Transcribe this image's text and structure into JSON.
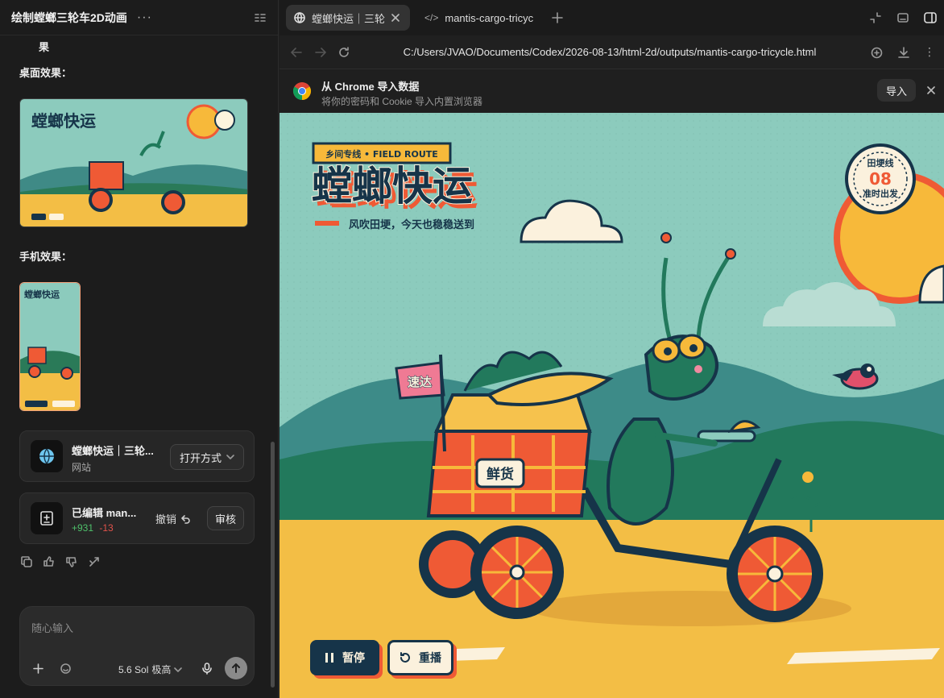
{
  "left": {
    "title": "绘制螳螂三轮车2D动画",
    "more": "···",
    "truncated_line": "果",
    "desktop_label": "桌面效果：",
    "mobile_label": "手机效果：",
    "website_card": {
      "title": "螳螂快运｜三轮...",
      "subtitle": "网站",
      "open_label": "打开方式"
    },
    "edit_card": {
      "title": "已编辑 man...",
      "added": "+931",
      "removed": "-13",
      "undo_label": "撤销",
      "review_label": "审核"
    },
    "composer": {
      "placeholder": "随心输入",
      "model": "5.6 Sol",
      "effort": "极高"
    }
  },
  "browser": {
    "tabs": [
      {
        "label": "螳螂快运｜三轮",
        "active": true
      },
      {
        "label": "mantis-cargo-tricyc",
        "active": false
      }
    ],
    "url": "C:/Users/JVAO/Documents/Codex/2026-08-13/html-2d/outputs/mantis-cargo-tricycle.html",
    "infobar": {
      "title": "从 Chrome 导入数据",
      "subtitle": "将你的密码和 Cookie 导入内置浏览器",
      "import_label": "导入"
    }
  },
  "scene": {
    "badge": "乡间专线 • FIELD ROUTE",
    "title": "螳螂快运",
    "tagline": "风吹田埂，今天也稳稳送到",
    "stamp_top": "田埂线",
    "stamp_num": "08",
    "stamp_bottom": "准时出发",
    "flag": "速达",
    "crate_label": "鲜货",
    "pause_label": "暂停",
    "replay_label": "重播"
  },
  "colors": {
    "sky": "#8ccbbd",
    "ground": "#f3be45",
    "accent": "#ef5a35",
    "navy": "#163449",
    "green": "#1f7a5b"
  }
}
